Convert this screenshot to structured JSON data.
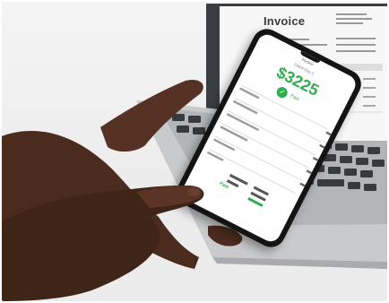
{
  "laptop": {
    "document_title": "Invoice"
  },
  "phone": {
    "header_text": "Invoice",
    "subtitle_text": "Client Day 1",
    "amount_text": "$3225",
    "status_text": "Paid",
    "paid_tag_text": "Paid"
  },
  "colors": {
    "accent_green": "#2eae4e",
    "skin": "#4a2b1d",
    "phone_body": "#141414"
  }
}
